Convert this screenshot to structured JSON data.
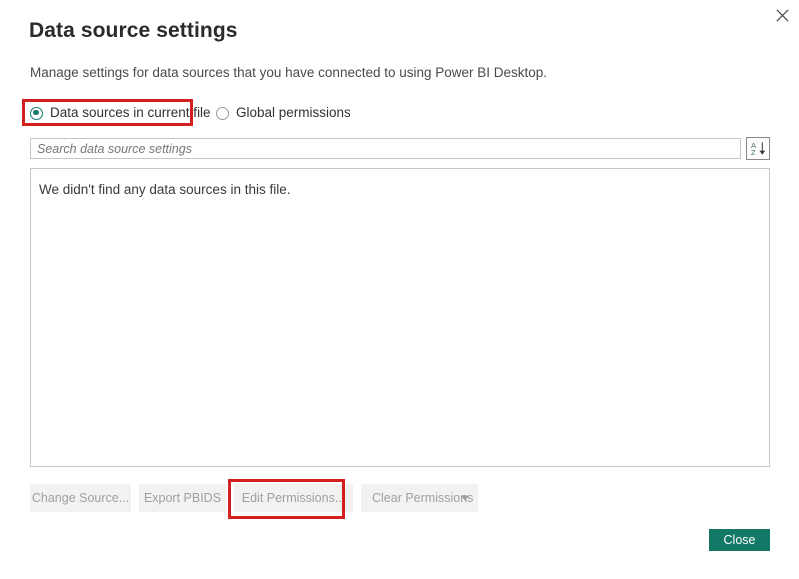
{
  "dialog": {
    "title": "Data source settings",
    "description": "Manage settings for data sources that you have connected to using Power BI Desktop.",
    "close_icon_name": "close-icon"
  },
  "scope": {
    "selected": "current_file",
    "options": [
      {
        "id": "current_file",
        "label": "Data sources in current file",
        "selected": true
      },
      {
        "id": "global_permissions",
        "label": "Global permissions",
        "selected": false
      }
    ]
  },
  "search": {
    "value": "",
    "placeholder": "Search data source settings",
    "sort_button": {
      "icon_name": "sort-az-icon",
      "letters_top": "A",
      "letters_bottom": "Z"
    }
  },
  "data_sources": {
    "items": [],
    "empty_message": "We didn't find any data sources in this file."
  },
  "actions": {
    "change_source": {
      "label": "Change Source...",
      "enabled": false
    },
    "export_pbids": {
      "label": "Export PBIDS",
      "enabled": false
    },
    "edit_permissions": {
      "label": "Edit Permissions...",
      "enabled": false
    },
    "clear_permissions": {
      "label": "Clear Permissions",
      "enabled": false,
      "caret_icon_name": "chevron-down-icon"
    }
  },
  "footer": {
    "close_label": "Close"
  },
  "annotations": [
    {
      "id": "scope-highlight",
      "target": "Data sources in current file",
      "color": "#d22020"
    },
    {
      "id": "edit-permissions-highlight",
      "target": "Edit Permissions...",
      "color": "#d22020"
    }
  ],
  "colors": {
    "accent": "#117865",
    "annotation": "#d22020",
    "title_text": "#2b2b2b",
    "body_text": "#4a4a4a",
    "disabled_text": "#a19f9d",
    "button_face": "#f3f2f1",
    "border": "#c8c6c4"
  }
}
